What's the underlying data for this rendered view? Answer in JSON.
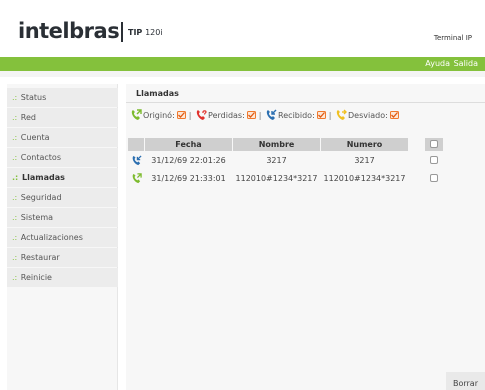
{
  "header": {
    "logo_text": "intelbras",
    "model_prefix": "TIP",
    "model_number": "120i",
    "terminal_label": "Terminal IP"
  },
  "topnav": {
    "ayuda": "Ayuda",
    "salida": "Salida"
  },
  "sidebar": {
    "items": [
      {
        "label": "Status"
      },
      {
        "label": "Red"
      },
      {
        "label": "Cuenta"
      },
      {
        "label": "Contactos"
      },
      {
        "label": "Llamadas",
        "active": true
      },
      {
        "label": "Seguridad"
      },
      {
        "label": "Sistema"
      },
      {
        "label": "Actualizaciones"
      },
      {
        "label": "Restaurar"
      },
      {
        "label": "Reinicie"
      }
    ],
    "bullet": ".:"
  },
  "content": {
    "title": "Llamadas",
    "filters": [
      {
        "label": "Originó:",
        "icon": "phone-outgoing-icon",
        "color": "#7dbb2e"
      },
      {
        "label": "Perdidas:",
        "icon": "phone-missed-icon",
        "color": "#e0302b"
      },
      {
        "label": "Recibido:",
        "icon": "phone-incoming-icon",
        "color": "#2c6fb0"
      },
      {
        "label": "Desviado:",
        "icon": "phone-forwarded-icon",
        "color": "#f0c020"
      }
    ],
    "separator": "|",
    "table": {
      "headers": [
        "Fecha",
        "Nombre",
        "Numero"
      ],
      "rows": [
        {
          "type": "phone-incoming-icon",
          "fecha": "31/12/69 22:01:26",
          "nombre": "3217",
          "numero": "3217"
        },
        {
          "type": "phone-outgoing-icon",
          "fecha": "31/12/69 21:33:01",
          "nombre": "112010#1234*3217",
          "numero": "112010#1234*3217"
        }
      ]
    },
    "delete_button": "Borrar"
  },
  "colors": {
    "accent_green": "#84c13c",
    "checkbox_orange": "#f0792c"
  }
}
